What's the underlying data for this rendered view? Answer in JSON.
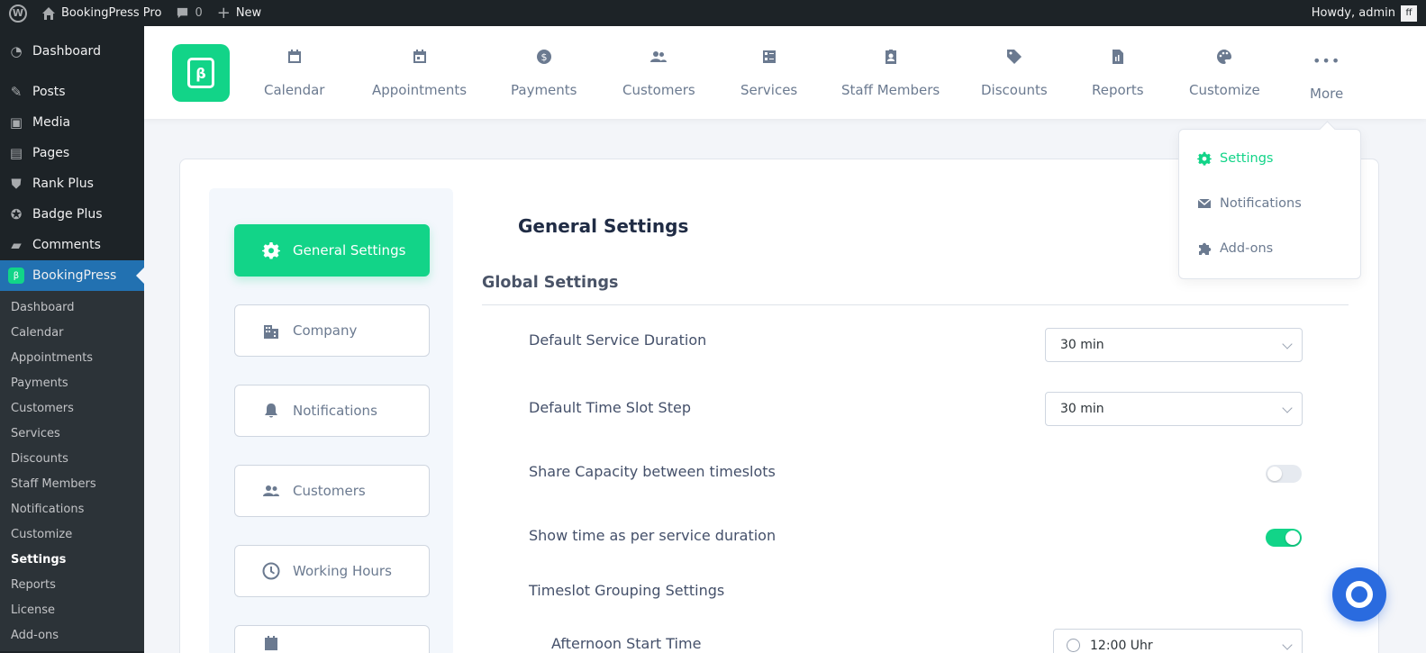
{
  "adminbar": {
    "site_name": "BookingPress Pro",
    "comments_count": "0",
    "new_label": "New",
    "greeting": "Howdy, admin"
  },
  "wp_menu": {
    "items": [
      {
        "label": "Dashboard",
        "icon": "dashboard-icon"
      },
      {
        "label": "Posts",
        "icon": "pin-icon"
      },
      {
        "label": "Media",
        "icon": "media-icon"
      },
      {
        "label": "Pages",
        "icon": "pages-icon"
      },
      {
        "label": "Rank Plus",
        "icon": "shield-icon"
      },
      {
        "label": "Badge Plus",
        "icon": "badge-icon"
      },
      {
        "label": "Comments",
        "icon": "comment-icon"
      },
      {
        "label": "BookingPress",
        "icon": "bookingpress-icon"
      }
    ],
    "submenu": [
      "Dashboard",
      "Calendar",
      "Appointments",
      "Payments",
      "Customers",
      "Services",
      "Discounts",
      "Staff Members",
      "Notifications",
      "Customize",
      "Settings",
      "Reports",
      "License",
      "Add-ons"
    ]
  },
  "topnav": {
    "items": [
      {
        "label": "Calendar",
        "icon": "calendar-icon"
      },
      {
        "label": "Appointments",
        "icon": "appointments-icon"
      },
      {
        "label": "Payments",
        "icon": "dollar-icon"
      },
      {
        "label": "Customers",
        "icon": "users-icon"
      },
      {
        "label": "Services",
        "icon": "services-icon"
      },
      {
        "label": "Staff Members",
        "icon": "staff-icon"
      },
      {
        "label": "Discounts",
        "icon": "tag-icon"
      },
      {
        "label": "Reports",
        "icon": "report-icon"
      },
      {
        "label": "Customize",
        "icon": "palette-icon"
      },
      {
        "label": "More",
        "icon": "ellipsis-icon"
      }
    ]
  },
  "more_dropdown": {
    "items": [
      {
        "label": "Settings",
        "icon": "gear-icon",
        "active": true
      },
      {
        "label": "Notifications",
        "icon": "envelope-icon",
        "active": false
      },
      {
        "label": "Add-ons",
        "icon": "puzzle-icon",
        "active": false
      }
    ]
  },
  "settings_tabs": [
    {
      "label": "General Settings",
      "icon": "gear-icon",
      "active": true
    },
    {
      "label": "Company",
      "icon": "building-icon"
    },
    {
      "label": "Notifications",
      "icon": "bell-icon"
    },
    {
      "label": "Customers",
      "icon": "users-icon"
    },
    {
      "label": "Working Hours",
      "icon": "clock-icon"
    }
  ],
  "main": {
    "title": "General Settings",
    "group_title": "Global Settings",
    "default_service_duration": {
      "label": "Default Service Duration",
      "value": "30 min"
    },
    "default_time_slot_step": {
      "label": "Default Time Slot Step",
      "value": "30 min"
    },
    "share_capacity": {
      "label": "Share Capacity between timeslots",
      "on": false
    },
    "show_time_per_duration": {
      "label": "Show time as per service duration",
      "on": true
    },
    "timeslot_grouping": {
      "label": "Timeslot Grouping Settings"
    },
    "afternoon_start": {
      "label": "Afternoon Start Time",
      "value": "12:00 Uhr"
    }
  },
  "colors": {
    "brand": "#12d488",
    "wp_dark": "#1d2327",
    "wp_active": "#2271b1",
    "help_button": "#2a6bdf"
  }
}
